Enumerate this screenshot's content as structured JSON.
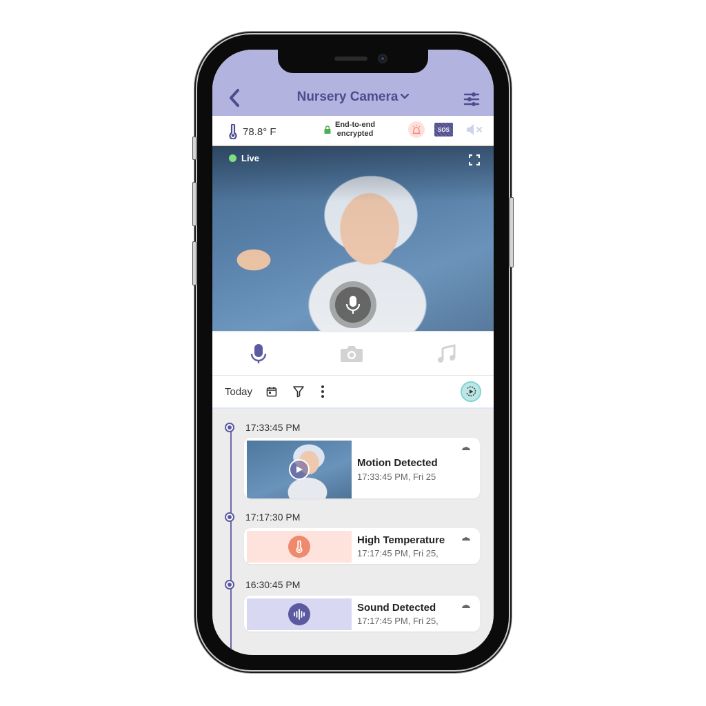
{
  "header": {
    "title": "Nursery Camera",
    "back_icon": "chevron-left-icon",
    "dropdown_icon": "chevron-down-icon",
    "settings_icon": "sliders-icon"
  },
  "status": {
    "temperature": "78.8° F",
    "encryption_line1": "End-to-end",
    "encryption_line2": "encrypted",
    "sos_label": "SOS"
  },
  "video": {
    "live_label": "Live",
    "live_color": "#7ee07e"
  },
  "tools": [
    "microphone",
    "camera",
    "music"
  ],
  "filter": {
    "date_label": "Today"
  },
  "events": [
    {
      "time": "17:33:45 PM",
      "title": "Motion Detected",
      "subtitle": "17:33:45 PM, Fri 25",
      "type": "motion"
    },
    {
      "time": "17:17:30 PM",
      "title": "High Temperature",
      "subtitle": "17:17:45 PM, Fri 25,",
      "type": "temperature",
      "bg_color": "#fde3dc",
      "icon_color": "#f08a6e"
    },
    {
      "time": "16:30:45 PM",
      "title": "Sound Detected",
      "subtitle": "17:17:45 PM, Fri 25,",
      "type": "sound",
      "bg_color": "#d8d8f2",
      "icon_color": "#5b5aa0"
    }
  ],
  "colors": {
    "header_bg": "#b3b3df",
    "accent": "#4c4c8f"
  }
}
